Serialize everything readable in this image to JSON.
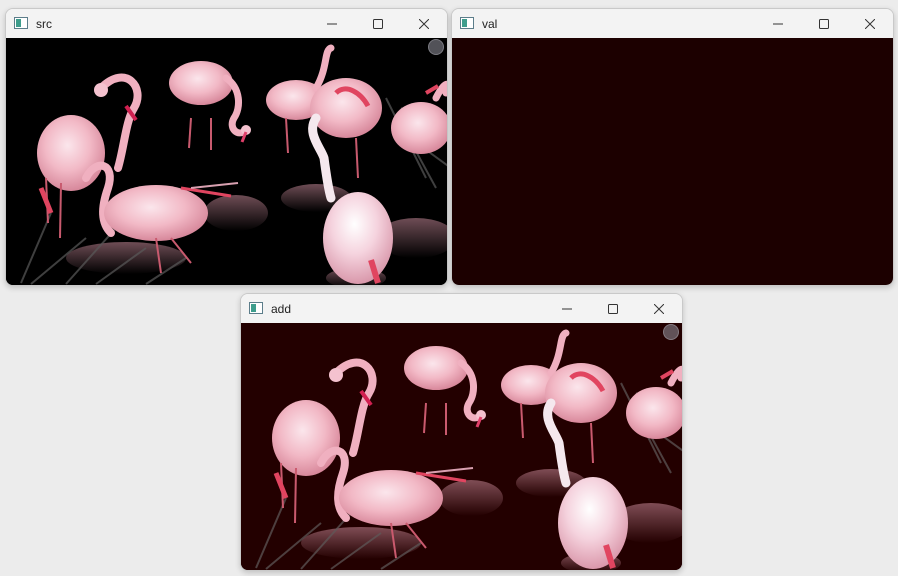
{
  "windows": {
    "src": {
      "title": "src"
    },
    "val": {
      "title": "val",
      "fill_color": "#1c0000"
    },
    "add": {
      "title": "add"
    }
  },
  "controls": {
    "minimize_icon": "minimize-icon",
    "maximize_icon": "maximize-icon",
    "close_icon": "close-icon"
  }
}
